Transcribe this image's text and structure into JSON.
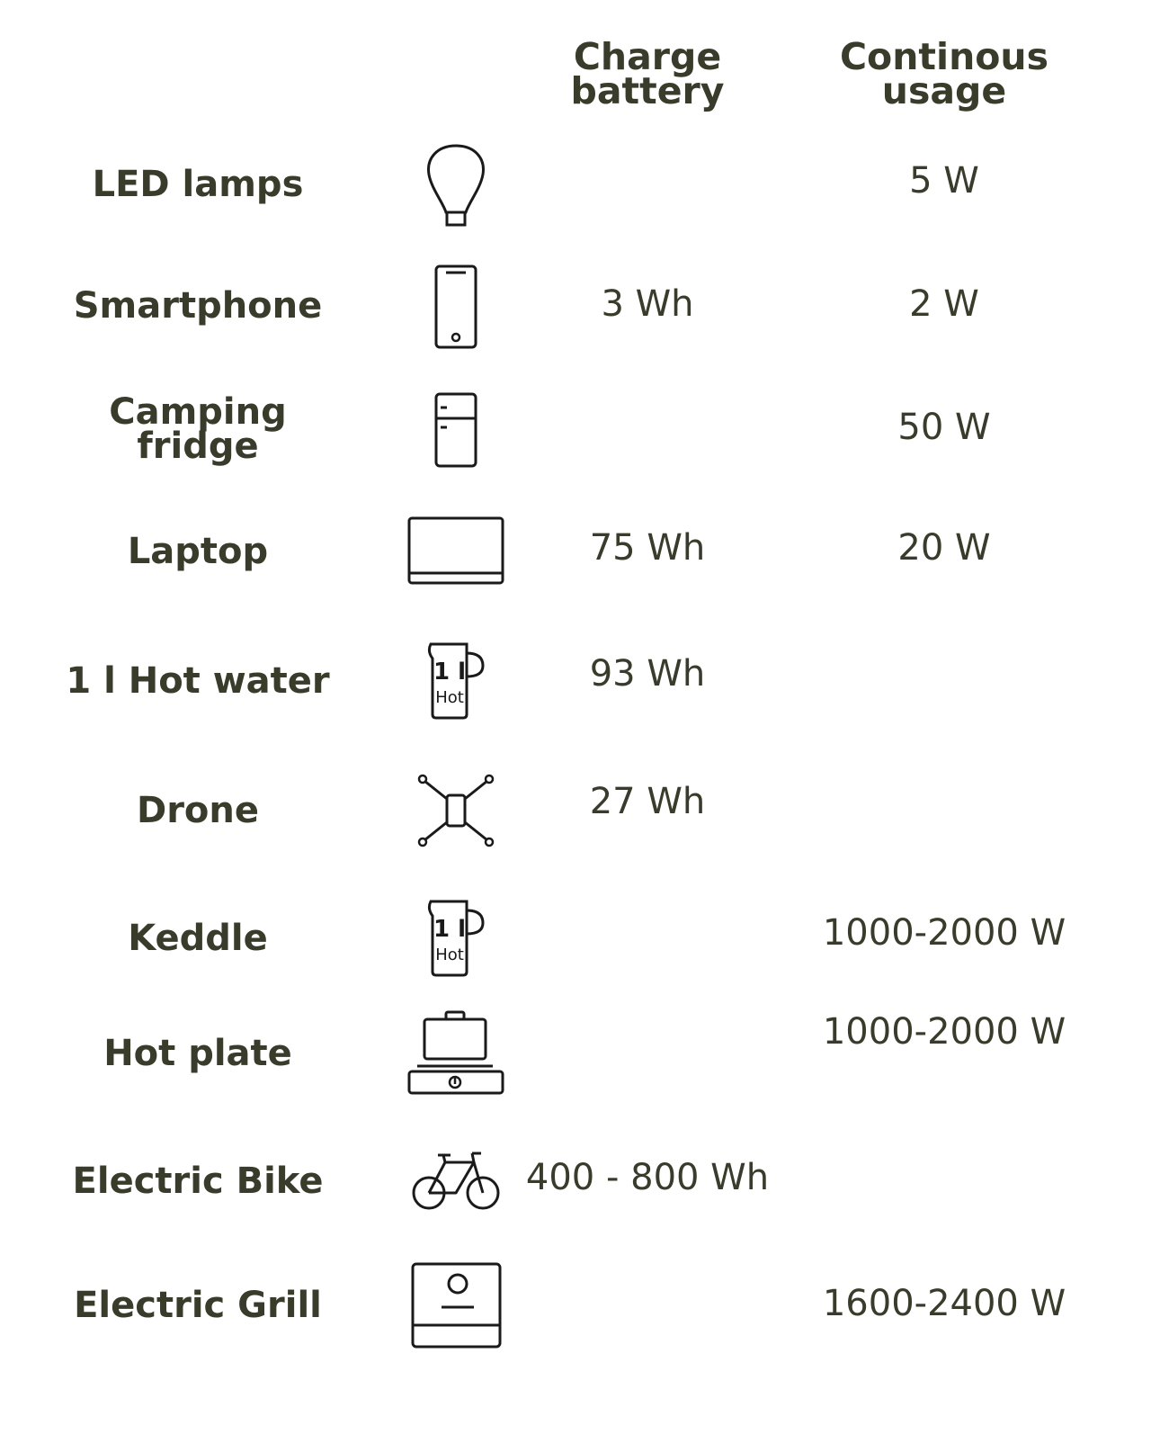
{
  "header": {
    "charge": "Charge\nbattery",
    "usage": "Continous\nusage"
  },
  "rows": [
    {
      "name": "LED  lamps",
      "icon": "light-bulb-icon",
      "charge": "",
      "usage": "5 W"
    },
    {
      "name": "Smartphone",
      "icon": "smartphone-icon",
      "charge": "3 Wh",
      "usage": "2 W"
    },
    {
      "name": "Camping\nfridge",
      "icon": "fridge-icon",
      "charge": "",
      "usage": "50 W"
    },
    {
      "name": "Laptop",
      "icon": "laptop-icon",
      "charge": "75 Wh",
      "usage": "20 W"
    },
    {
      "name": "1 l Hot water",
      "icon": "hot-water-jug-icon",
      "charge": "93 Wh",
      "usage": "",
      "icon_text": [
        "1 l",
        "Hot"
      ]
    },
    {
      "name": "Drone",
      "icon": "drone-icon",
      "charge": "27 Wh",
      "usage": ""
    },
    {
      "name": "Keddle",
      "icon": "kettle-icon",
      "charge": "",
      "usage": "1000-2000 W",
      "icon_text": [
        "1 l",
        "Hot"
      ]
    },
    {
      "name": "Hot plate",
      "icon": "hot-plate-icon",
      "charge": "",
      "usage": "1000-2000 W"
    },
    {
      "name": "Electric Bike",
      "icon": "bicycle-icon",
      "charge": "400 - 800 Wh",
      "usage": ""
    },
    {
      "name": "Electric Grill",
      "icon": "electric-grill-icon",
      "charge": "",
      "usage": "1600-2400 W"
    }
  ]
}
